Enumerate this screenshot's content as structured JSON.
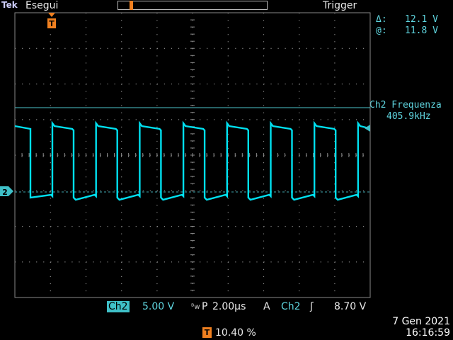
{
  "header": {
    "brand_prefix": "Tek",
    "status": "Esegui",
    "trigger_label": "Trigger"
  },
  "cursors": {
    "delta_label": "Δ:",
    "delta_value": "12.1 V",
    "at_label": "@:",
    "at_value": "11.8 V"
  },
  "measurement": {
    "title": "Ch2 Frequenza",
    "value": "405.9kHz"
  },
  "channel_marker": "2",
  "trigger_marker": "T",
  "footer": {
    "channel": "Ch2",
    "volts_div": "5.00 V",
    "bw_flag": "ᴮw",
    "timebase_mode": "P",
    "time_div": "2.00µs",
    "trigger_mode": "A",
    "trigger_source": "Ch2",
    "trigger_slope": "ʃ",
    "trigger_level": "8.70 V",
    "trigger_pos_icon": "T",
    "trigger_pos": "10.40 %",
    "date": "7 Gen  2021",
    "time": "16:16:59"
  },
  "colors": {
    "trace": "#00e0f0",
    "grid": "#777777",
    "accent": "#f08020"
  }
}
